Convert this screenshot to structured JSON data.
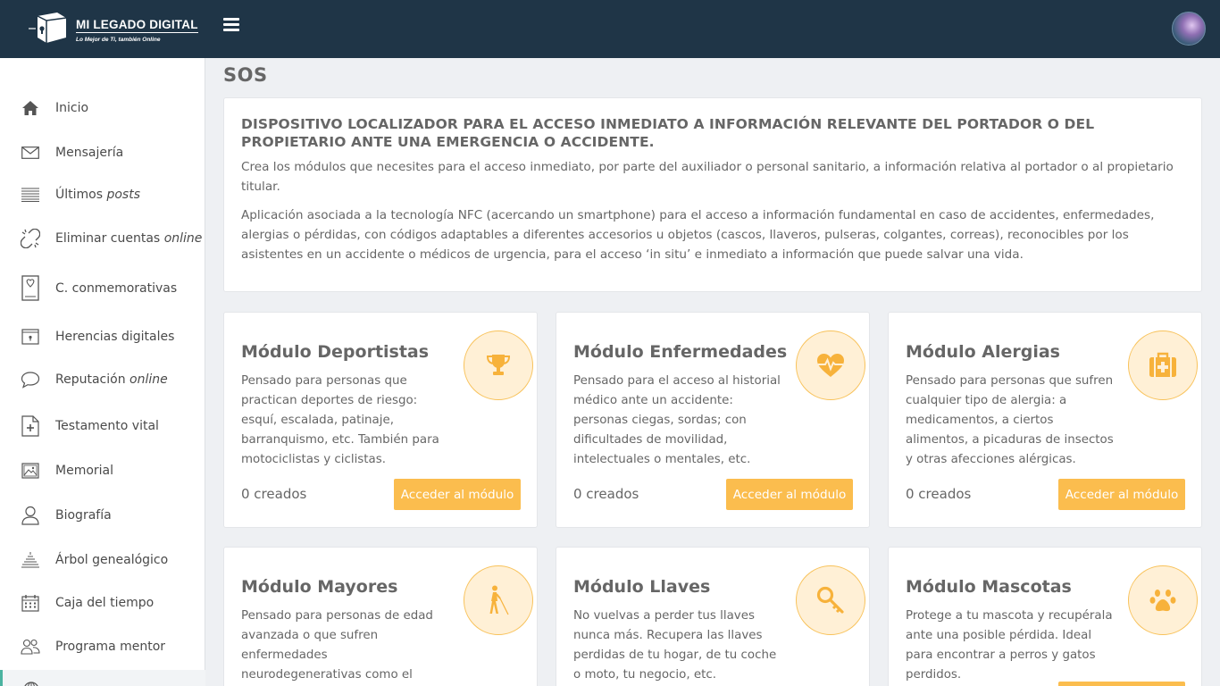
{
  "header": {
    "brand": "MI LEGADO DIGITAL",
    "tagline": "Lo Mejor de Ti, también Online",
    "menu_icon": "hamburger-icon",
    "avatar_icon": "user-avatar"
  },
  "sidebar": {
    "items": [
      {
        "label": "Inicio",
        "em": "",
        "icon": "home-icon"
      },
      {
        "label": "Mensajería",
        "em": "",
        "icon": "envelope-icon"
      },
      {
        "label": "Últimos ",
        "em": "posts",
        "icon": "lines-icon"
      },
      {
        "label": "Eliminar cuentas ",
        "em": "online",
        "icon": "broken-link-icon"
      },
      {
        "label": "C. conmemorativas",
        "em": "",
        "icon": "memorial-book-icon"
      },
      {
        "label": "Herencias digitales",
        "em": "",
        "icon": "safe-box-icon"
      },
      {
        "label": "Reputación ",
        "em": "online",
        "icon": "speech-bubble-icon"
      },
      {
        "label": "Testamento vital",
        "em": "",
        "icon": "document-plus-icon"
      },
      {
        "label": "Memorial",
        "em": "",
        "icon": "picture-icon"
      },
      {
        "label": "Biografía",
        "em": "",
        "icon": "person-icon"
      },
      {
        "label": "Árbol genealógico",
        "em": "",
        "icon": "tree-icon"
      },
      {
        "label": "Caja del tiempo",
        "em": "",
        "icon": "calendar-icon"
      },
      {
        "label": "Programa mentor",
        "em": "",
        "icon": "people-icon"
      }
    ]
  },
  "main": {
    "title": "SOS",
    "intro": {
      "heading": "DISPOSITIVO LOCALIZADOR PARA EL ACCESO INMEDIATO A INFORMACIÓN RELEVANTE DEL PORTADOR O DEL PROPIETARIO ANTE UNA EMERGENCIA O ACCIDENTE.",
      "p1": "Crea los módulos que necesites para el acceso inmediato, por parte del auxiliador o personal sanitario, a información relativa al portador o al propietario titular.",
      "p2": "Aplicación asociada a la tecnología NFC (acercando un smartphone) para el acceso a información fundamental en caso de accidentes, enfermedades, alergias o pérdidas, con códigos adaptables a diferentes accesorios u objetos (cascos, llaveros, pulseras, colgantes, correas), reconocibles por los asistentes en un accidente o médicos de urgencia, para el acceso ‘in situ’ e inmediato a información que puede salvar una vida."
    },
    "modules": [
      {
        "title": "Módulo Deportistas",
        "desc": "Pensado para personas que practican deportes de riesgo: esquí, escalada, patinaje, barranquismo, etc. También para motociclistas y ciclistas.",
        "count": "0 creados",
        "button": "Acceder al módulo",
        "icon": "trophy-icon"
      },
      {
        "title": "Módulo Enfermedades",
        "desc": "Pensado para el acceso al historial médico ante un accidente: personas ciegas, sordas; con dificultades de movilidad, intelectuales o mentales, etc.",
        "count": "0 creados",
        "button": "Acceder al módulo",
        "icon": "heartbeat-icon"
      },
      {
        "title": "Módulo Alergias",
        "desc": "Pensado para personas que sufren cualquier tipo de alergia: a medicamentos, a ciertos alimentos, a picaduras de insectos y otras afecciones alérgicas.",
        "count": "0 creados",
        "button": "Acceder al módulo",
        "icon": "first-aid-kit-icon"
      },
      {
        "title": "Módulo Mayores",
        "desc": "Pensado para personas de edad avanzada o que sufren enfermedades neurodegenerativas como el Alzheimer o cualquier tipo",
        "count": "",
        "button": "",
        "icon": "blind-person-icon"
      },
      {
        "title": "Módulo Llaves",
        "desc": "No vuelvas a perder tus llaves nunca más. Recupera las llaves perdidas de tu hogar, de tu coche o moto, tu negocio, etc.",
        "count": "",
        "button": "",
        "icon": "key-icon"
      },
      {
        "title": "Módulo Mascotas",
        "desc": "Protege a tu mascota y recupérala ante una posible pérdida. Ideal para encontrar a perros y gatos perdidos.",
        "count": "",
        "button": "",
        "icon": "paw-icon"
      }
    ]
  },
  "colors": {
    "topbar": "#1f3547",
    "accent": "#fbbd4e",
    "icon_circle_bg": "#fff0d6",
    "icon_circle_border": "#f8c25a",
    "active_marker": "#4bb3a0"
  }
}
